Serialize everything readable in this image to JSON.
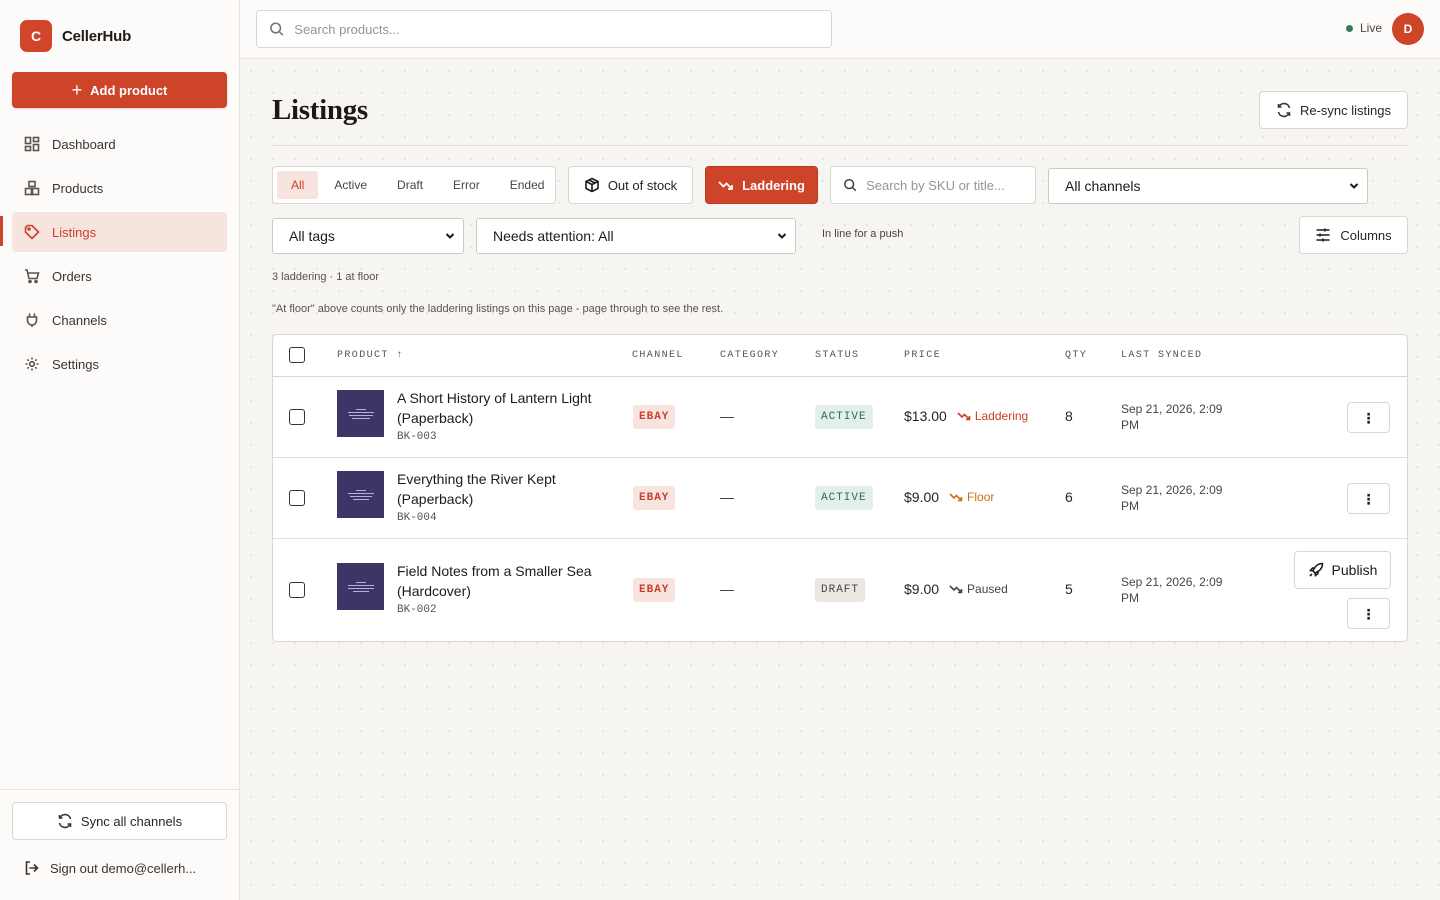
{
  "app": {
    "logo_letter": "C",
    "name": "CellerHub"
  },
  "sidebar": {
    "add_label": "Add product",
    "items": [
      {
        "label": "Dashboard",
        "icon": "dashboard-icon"
      },
      {
        "label": "Products",
        "icon": "products-icon"
      },
      {
        "label": "Listings",
        "icon": "tag-icon",
        "active": true
      },
      {
        "label": "Orders",
        "icon": "cart-icon"
      },
      {
        "label": "Channels",
        "icon": "plug-icon"
      },
      {
        "label": "Settings",
        "icon": "gear-icon"
      }
    ],
    "sync_label": "Sync all channels",
    "signout_label": "Sign out demo@cellerh..."
  },
  "topbar": {
    "search_placeholder": "Search products...",
    "live_label": "Live",
    "avatar_initial": "D"
  },
  "page": {
    "title": "Listings",
    "resync_label": "Re-sync listings",
    "status_tabs": [
      "All",
      "Active",
      "Draft",
      "Error",
      "Ended"
    ],
    "active_tab": "All",
    "out_of_stock_label": "Out of stock",
    "laddering_label": "Laddering",
    "sku_search_placeholder": "Search by SKU or title...",
    "channels_select": "All channels",
    "tags_select": "All tags",
    "attention_select": "Needs attention: All",
    "hint": "In line for a push",
    "columns_label": "Columns",
    "summary": "3 laddering · 1 at floor",
    "note": "\"At floor\" above counts only the laddering listings on this page - page through to see the rest."
  },
  "table": {
    "headers": {
      "product": "PRODUCT ↑",
      "channel": "CHANNEL",
      "category": "CATEGORY",
      "status": "STATUS",
      "price": "PRICE",
      "qty": "QTY",
      "last_synced": "LAST SYNCED"
    },
    "rows": [
      {
        "title": "A Short History of Lantern Light (Paperback)",
        "sku": "BK-003",
        "channel": "EBAY",
        "category": "—",
        "status": "ACTIVE",
        "price": "$13.00",
        "trend": "Laddering",
        "qty": "8",
        "synced": "Sep 21, 2026, 2:09 PM"
      },
      {
        "title": "Everything the River Kept (Paperback)",
        "sku": "BK-004",
        "channel": "EBAY",
        "category": "—",
        "status": "ACTIVE",
        "price": "$9.00",
        "trend": "Floor",
        "qty": "6",
        "synced": "Sep 21, 2026, 2:09 PM"
      },
      {
        "title": "Field Notes from a Smaller Sea (Hardcover)",
        "sku": "BK-002",
        "channel": "EBAY",
        "category": "—",
        "status": "DRAFT",
        "price": "$9.00",
        "trend": "Paused",
        "qty": "5",
        "synced": "Sep 21, 2026, 2:09 PM",
        "publish_label": "Publish"
      }
    ],
    "kebab_glyph": "⋮"
  }
}
